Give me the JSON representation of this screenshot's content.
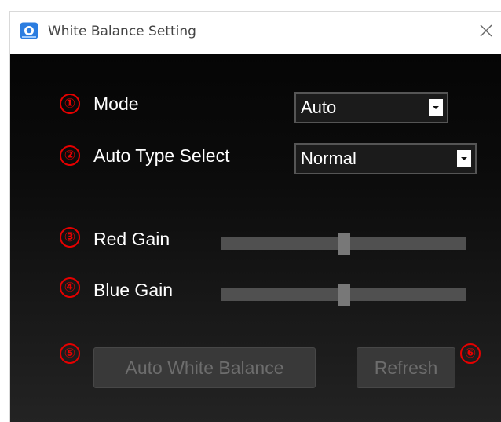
{
  "window": {
    "title": "White Balance Setting"
  },
  "badges": [
    "①",
    "②",
    "③",
    "④",
    "⑤",
    "⑥"
  ],
  "mode": {
    "label": "Mode",
    "value": "Auto"
  },
  "auto_type": {
    "label": "Auto Type Select",
    "value": "Normal"
  },
  "red_gain": {
    "label": "Red Gain",
    "level": 0.5
  },
  "blue_gain": {
    "label": "Blue Gain",
    "level": 0.5
  },
  "buttons": {
    "auto_white_balance": "Auto White Balance",
    "refresh": "Refresh"
  },
  "colors": {
    "badge": "#e60000",
    "background": "#0a0a0a",
    "disabled_button": "#393939"
  }
}
